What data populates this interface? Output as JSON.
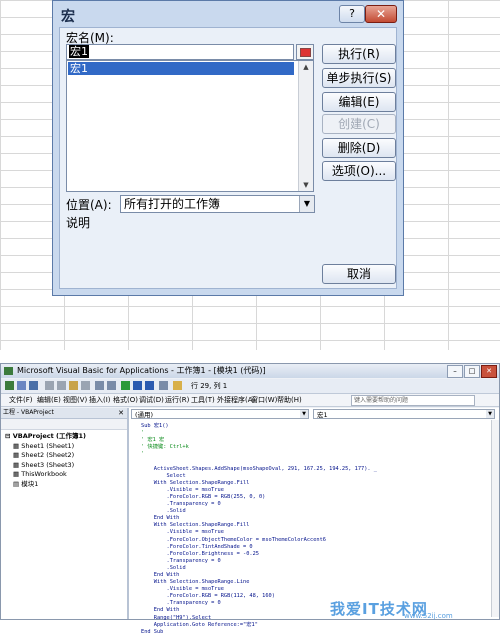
{
  "dialog": {
    "title": "宏",
    "help": "?",
    "close": "✕",
    "name_label": "宏名(M):",
    "name_value": "宏1",
    "list_items": [
      "宏1"
    ],
    "location_label": "位置(A):",
    "location_value": "所有打开的工作簿",
    "description_label": "说明",
    "buttons": {
      "run": "执行(R)",
      "step": "单步执行(S)",
      "edit": "编辑(E)",
      "create": "创建(C)",
      "delete": "删除(D)",
      "options": "选项(O)...",
      "cancel": "取消"
    }
  },
  "vba": {
    "title": "Microsoft Visual Basic for Applications - 工作簿1 - [模块1 (代码)]",
    "position": "行 29, 列 1",
    "menu": [
      "文件(F)",
      "编辑(E)",
      "视图(V)",
      "插入(I)",
      "格式(O)",
      "调试(D)",
      "运行(R)",
      "工具(T)",
      "外接程序(A)",
      "窗口(W)",
      "帮助(H)"
    ],
    "help_placeholder": "键入需要帮助的问题",
    "project_title": "工程 - VBAProject",
    "tree": [
      "VBAProject (工作簿1)",
      "Sheet1 (Sheet1)",
      "Sheet2 (Sheet2)",
      "Sheet3 (Sheet3)",
      "ThisWorkbook",
      "模块1"
    ],
    "combo_object": "(通用)",
    "combo_proc": "宏1",
    "code_lines": [
      "Sub 宏1()",
      "'",
      "' 宏1 宏",
      "' 快捷键: Ctrl+k",
      "'",
      "",
      "    ActiveSheet.Shapes.AddShape(msoShapeOval, 291, 167.25, 194.25, 177). _",
      "        Select",
      "    With Selection.ShapeRange.Fill",
      "        .Visible = msoTrue",
      "        .ForeColor.RGB = RGB(255, 0, 0)",
      "        .Transparency = 0",
      "        .Solid",
      "    End With",
      "    With Selection.ShapeRange.Fill",
      "        .Visible = msoTrue",
      "        .ForeColor.ObjectThemeColor = msoThemeColorAccent6",
      "        .ForeColor.TintAndShade = 0",
      "        .ForeColor.Brightness = -0.25",
      "        .Transparency = 0",
      "        .Solid",
      "    End With",
      "    With Selection.ShapeRange.Line",
      "        .Visible = msoTrue",
      "        .ForeColor.RGB = RGB(112, 48, 160)",
      "        .Transparency = 0",
      "    End With",
      "    Range(\"H9\").Select",
      "    Application.Goto Reference:=\"宏1\"",
      "End Sub"
    ]
  },
  "watermark": {
    "brand": "我爱IT技术网",
    "url": "www.52ij.com"
  }
}
